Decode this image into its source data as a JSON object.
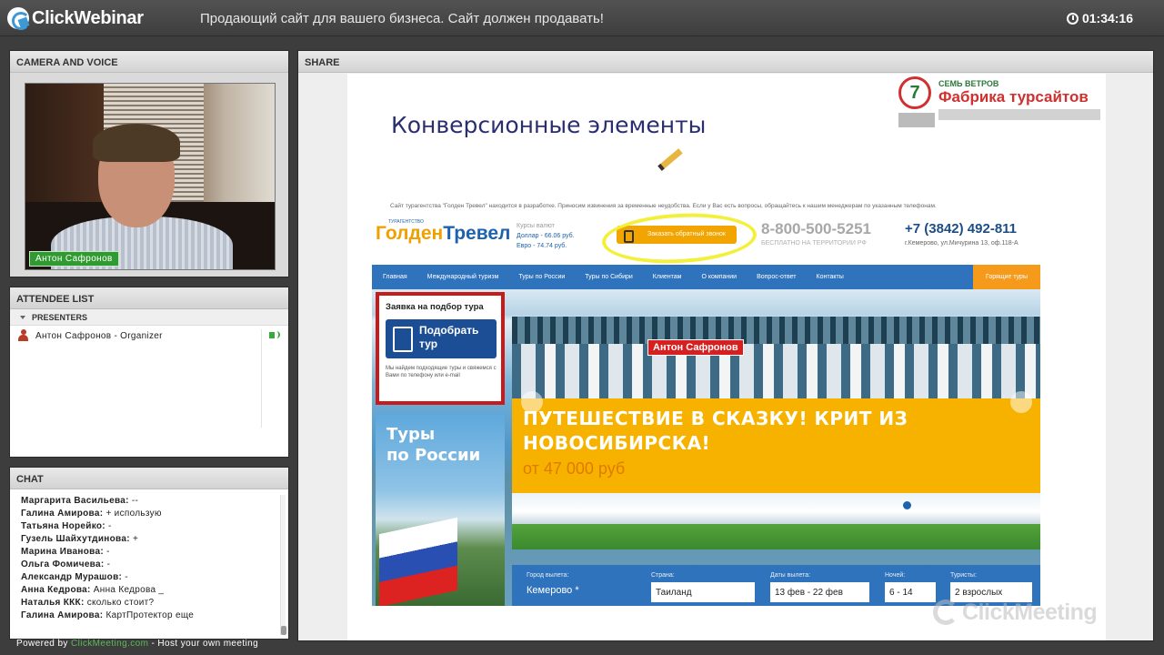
{
  "app": {
    "brand": "ClickWebinar",
    "title": "Продающий сайт для вашего бизнеса. Сайт должен продавать!",
    "timer": "01:34:16"
  },
  "camera_panel": {
    "header": "CAMERA AND VOICE",
    "presenter_name": "Антон Сафронов"
  },
  "attendee_panel": {
    "header": "ATTENDEE LIST",
    "group": "PRESENTERS",
    "attendees": [
      {
        "name": "Антон Сафронов - Organizer"
      }
    ]
  },
  "chat_panel": {
    "header": "CHAT",
    "messages": [
      {
        "author": "Маргарита Васильева:",
        "text": "--"
      },
      {
        "author": "Галина Амирова:",
        "text": "+ использую"
      },
      {
        "author": "Татьяна Норейко:",
        "text": "-"
      },
      {
        "author": "Гузель Шайхутдинова:",
        "text": "+"
      },
      {
        "author": "Марина Иванова:",
        "text": "-"
      },
      {
        "author": "Ольга  Фомичева:",
        "text": "-"
      },
      {
        "author": "Александр Мурашов:",
        "text": "-"
      },
      {
        "author": "Анна Кедрова:",
        "text": "Анна Кедрова _"
      },
      {
        "author": "Наталья ККК:",
        "text": "сколько стоит?"
      },
      {
        "author": "Галина Амирова:",
        "text": "КартПротектор еще"
      }
    ]
  },
  "footer": {
    "prefix": "Powered by",
    "link": "ClickMeeting.com",
    "suffix": "- Host your own meeting"
  },
  "share_panel": {
    "header": "SHARE",
    "watermark": "ClickMeeting",
    "annotation_label": "Антон Сафронов",
    "slide": {
      "title": "Конверсионные элементы",
      "brand_small": "СЕМЬ ВЕТРОВ",
      "brand_name": "Фабрика турсайтов",
      "brand_mark": "7",
      "site": {
        "notice": "Сайт турагентства \"Голден Тревел\" находится в разработке. Приносим извинения за временные неудобства. Если у Вас есть вопросы, обращайтесь к нашим менеджерам по указанным телефонам.",
        "logo_small": "ТУРАГЕНТСТВО",
        "logo_a": "Голден",
        "logo_b": "Тревел",
        "rates_label": "Курсы валют",
        "rate_usd_label": "Доллар",
        "rate_usd": "- 66.06 руб.",
        "rate_eur_label": "Евро",
        "rate_eur": "- 74.74 руб.",
        "callback_button": "Заказать обратный звонок",
        "phone_free": "8-800-500-5251",
        "phone_free_note": "БЕСПЛАТНО НА ТЕРРИТОРИИ РФ",
        "phone_local": "+7 (3842) 492-811",
        "address": "г.Кемерово, ул.Мичурина 13, оф.118-А",
        "nav": [
          "Главная",
          "Международный туризм",
          "Туры по России",
          "Туры по Сибири",
          "Клиентам",
          "О компании",
          "Вопрос-ответ",
          "Контакты"
        ],
        "nav_hot": "Горящие туры",
        "request_title": "Заявка на подбор тура",
        "request_button_l1": "Подобрать",
        "request_button_l2": "тур",
        "request_note": "Мы найдем подходящие туры и свяжемся с Вами по телефону или e-mail",
        "russia_l1": "Туры",
        "russia_l2": "по России",
        "banner_l1": "ПУТЕШЕСТВИЕ В СКАЗКУ! КРИТ ИЗ",
        "banner_l2": "НОВОСИБИРСКА!",
        "banner_price": "от 47 000 руб",
        "form": {
          "from_label": "Город вылета:",
          "from_value": "Кемерово *",
          "country_label": "Страна:",
          "country_value": "Таиланд",
          "dates_label": "Даты вылета:",
          "dates_value": "13 фев - 22 фев",
          "nights_label": "Ночей:",
          "nights_value": "6 - 14",
          "tourists_label": "Туристы:",
          "tourists_value": "2 взрослых"
        }
      }
    }
  }
}
